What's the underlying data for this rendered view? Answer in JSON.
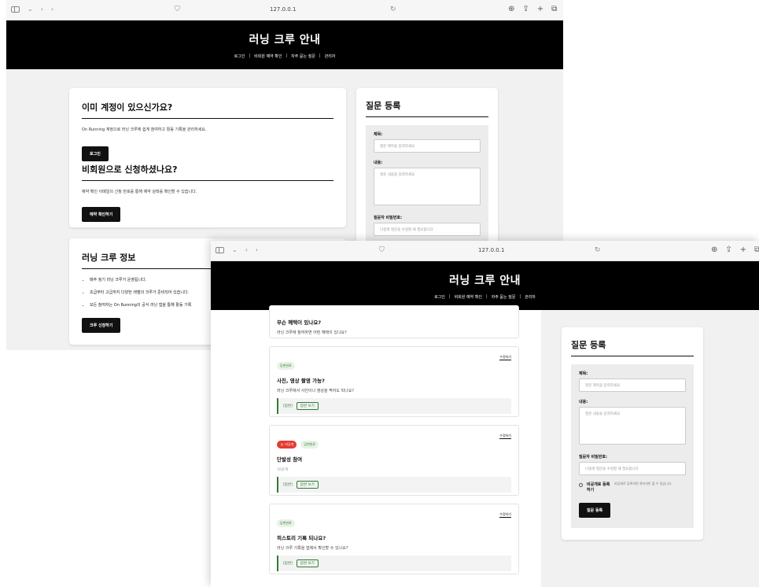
{
  "window1": {
    "url": "127.0.0.1",
    "header": {
      "title": "러닝 크루 안내",
      "nav": [
        "로그인",
        "비회원 예약 확인",
        "자주 묻는 질문",
        "관리자"
      ],
      "sep": "|"
    },
    "account_card": {
      "title": "이미 계정이 있으신가요?",
      "desc": "On Running 계정으로 러닝 크루에 쉽게 참여하고 활동 기록을 관리하세요.",
      "login_button": "로그인",
      "guest_title": "비회원으로 신청하셨나요?",
      "guest_desc": "예약 확인 이메일의 신청 번호를 통해 예약 상태를 확인할 수 있습니다.",
      "reservation_button": "예약 확인하기"
    },
    "info_card": {
      "title": "러닝 크루 정보",
      "items": [
        "매주 정기 러닝 크루가 운영됩니다.",
        "초급부터 고급까지 다양한 레벨의 크루가 준비되어 있습니다.",
        "모든 참여자는 On Running의 공식 러닝 앱을 통해 활동 기록"
      ],
      "apply_button": "크루 신청하기"
    },
    "question_form": {
      "title": "질문 등록",
      "subject_label": "제목:",
      "subject_placeholder": "질문 제목을 입력하세요",
      "content_label": "내용:",
      "content_placeholder": "질문 내용을 입력하세요",
      "password_label": "질문자 비밀번호:",
      "password_placeholder": "나중에 질문을 수정할 때 필요합니다"
    }
  },
  "window2": {
    "url": "127.0.0.1",
    "header": {
      "title": "러닝 크루 안내",
      "nav": [
        "로그인",
        "비회원 예약 확인",
        "자주 묻는 질문",
        "관리자"
      ],
      "sep": "|"
    },
    "questions": [
      {
        "title": "무슨 혜택이 있나요?",
        "body": "러닝 크루에 참여하면 어떤 혜택이 있나요?"
      },
      {
        "badge": "답변완료",
        "edit": "수정하기",
        "title": "사진, 영상 촬영 가능?",
        "body": "러닝 크루에서 사진이나 영상을 찍어도 되나요?",
        "answer_label": "[답변]",
        "answer_button": "답변 보기"
      },
      {
        "secret_badge": "🔒 비공개",
        "badge": "답변완료",
        "edit": "수정하기",
        "title": "단발성 참여",
        "body": "비공개",
        "answer_label": "[답변]",
        "answer_button": "답변 보기"
      },
      {
        "badge": "답변완료",
        "edit": "수정하기",
        "title": "히스토리 기록 되나요?",
        "body": "러닝 크루 기록을 앱에서 확인할 수 있나요?",
        "answer_label": "[답변]",
        "answer_button": "답변 보기"
      }
    ],
    "question_form": {
      "title": "질문 등록",
      "subject_label": "제목:",
      "subject_placeholder": "질문 제목을 입력하세요",
      "content_label": "내용:",
      "content_placeholder": "질문 내용을 입력하세요",
      "password_label": "질문자 비밀번호:",
      "password_placeholder": "나중에 질문을 수정할 때 필요합니다",
      "private_label": "비공개로 등록하기",
      "private_hint": "비공개로 등록하면 관리자만 볼 수 있습니다.",
      "submit_button": "질문 등록"
    }
  }
}
